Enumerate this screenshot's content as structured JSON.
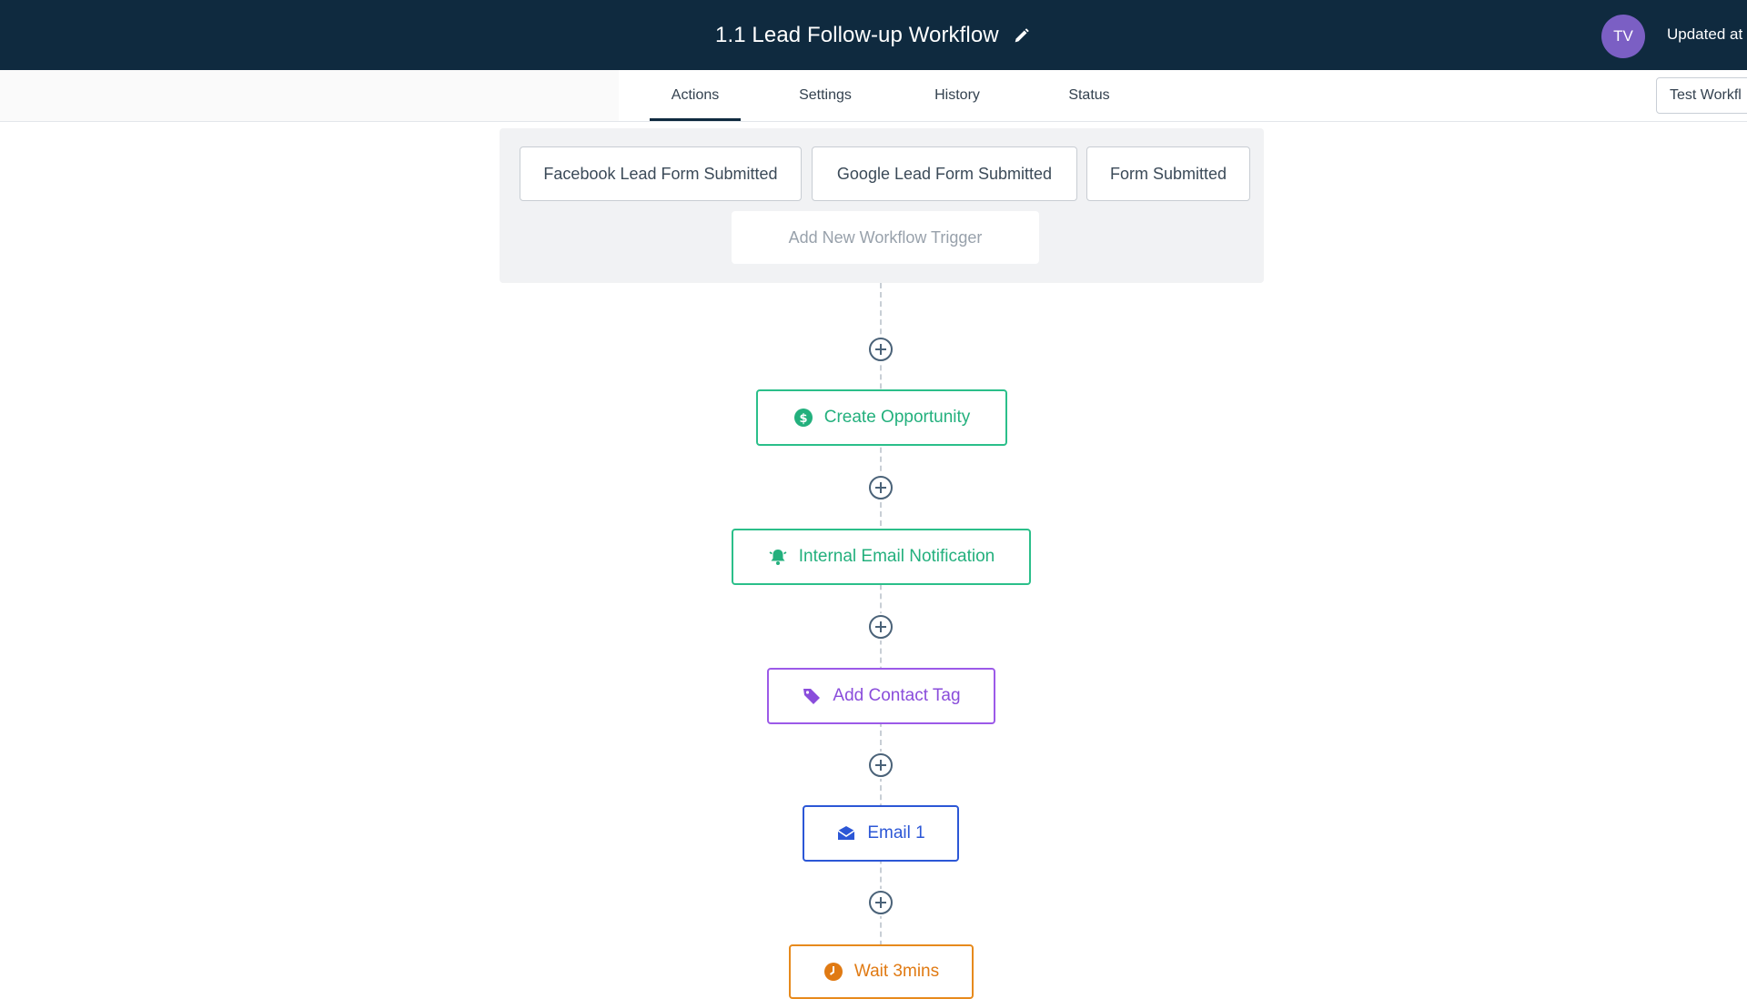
{
  "header": {
    "title": "1.1 Lead Follow-up Workflow",
    "avatar_initials": "TV",
    "updated_text": "Updated at",
    "edit_icon": "pencil-icon"
  },
  "tabs": [
    {
      "label": "Actions",
      "active": true
    },
    {
      "label": "Settings",
      "active": false
    },
    {
      "label": "History",
      "active": false
    },
    {
      "label": "Status",
      "active": false
    }
  ],
  "test_button": {
    "label": "Test Workfl"
  },
  "triggers": {
    "items": [
      {
        "label": "Facebook Lead Form Submitted"
      },
      {
        "label": "Google Lead Form Submitted"
      },
      {
        "label": "Form Submitted"
      }
    ],
    "add_label": "Add New Workflow Trigger"
  },
  "actions": [
    {
      "label": "Create Opportunity",
      "icon": "dollar-icon",
      "color": "#23b07d"
    },
    {
      "label": "Internal Email Notification",
      "icon": "bell-icon",
      "color": "#23b07d"
    },
    {
      "label": "Add Contact Tag",
      "icon": "tag-icon",
      "color": "#8a4ddb"
    },
    {
      "label": "Email 1",
      "icon": "email-icon",
      "color": "#2c57d6"
    },
    {
      "label": "Wait 3mins",
      "icon": "clock-icon",
      "color": "#e07a13"
    }
  ],
  "colors": {
    "header_bg": "#0f2a3f",
    "avatar_bg": "#7b5fc4",
    "connector": "#c8ced5",
    "plus_icon": "#4a6278"
  }
}
